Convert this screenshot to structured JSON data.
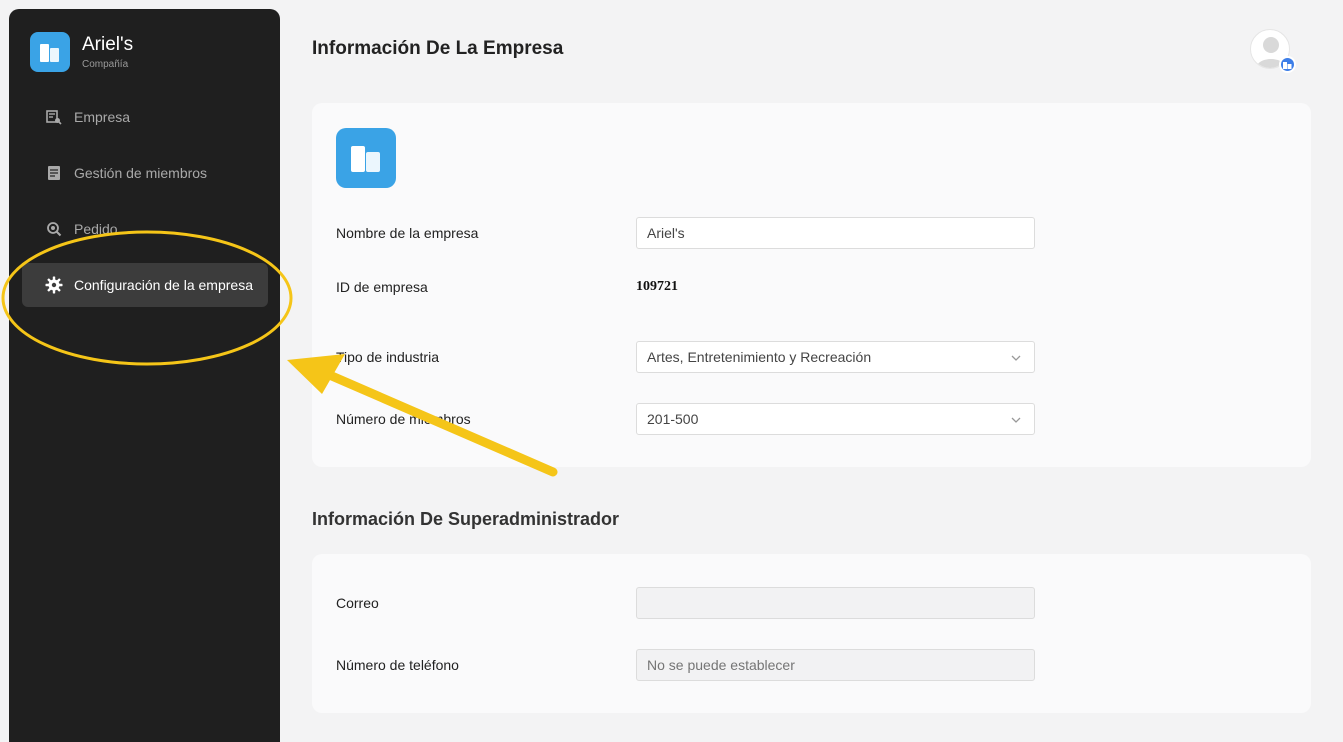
{
  "brand": {
    "name": "Ariel's",
    "subtitle": "Compañía"
  },
  "sidebar": {
    "items": [
      {
        "label": "Empresa",
        "icon": "company-search-icon",
        "active": false
      },
      {
        "label": "Gestión de miembros",
        "icon": "member-list-icon",
        "active": false
      },
      {
        "label": "Pedido",
        "icon": "order-search-icon",
        "active": false
      },
      {
        "label": "Configuración de la empresa",
        "icon": "gear-icon",
        "active": true
      }
    ]
  },
  "header": {
    "title": "Información De La Empresa"
  },
  "company": {
    "name_label": "Nombre de la empresa",
    "name_value": "Ariel's",
    "id_label": "ID de empresa",
    "id_value": "109721",
    "industry_label": "Tipo de industria",
    "industry_value": "Artes, Entretenimiento y Recreación",
    "members_label": "Número de miembros",
    "members_value": "201-500"
  },
  "superadmin": {
    "section_title": "Información De Superadministrador",
    "email_label": "Correo",
    "email_value": "",
    "phone_label": "Número de teléfono",
    "phone_placeholder": "No se puede establecer"
  },
  "colors": {
    "accent": "#3aa3e6",
    "highlight": "#f5c518",
    "sidebar": "#1f1f1f"
  }
}
